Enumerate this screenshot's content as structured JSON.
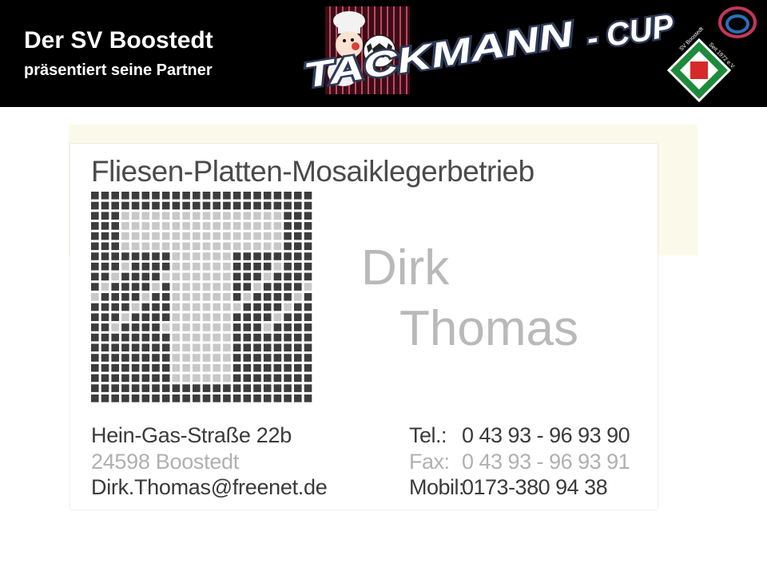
{
  "header": {
    "title": "Der SV Boostedt",
    "subtitle": "präsentiert seine Partner",
    "cup_logo_text": "TACKMANN - CUP",
    "club_badge_text": "SV Boostedt Seit 1972 e.V."
  },
  "card": {
    "trade": "Fliesen-Platten-Mosaiklegerbetrieb",
    "first_name": "Dirk",
    "last_name": "Thomas",
    "street": "Hein-Gas-Straße 22b",
    "city": "24598 Boostedt",
    "email": "Dirk.Thomas@freenet.de",
    "tel_label": "Tel.:",
    "tel": "0 43 93 - 96 93 90",
    "fax_label": "Fax:",
    "fax": "0 43 93 - 96 93 91",
    "mobile_label": "Mobil:",
    "mobile": "0173-380 94 38"
  },
  "colors": {
    "banner": "#000000",
    "cup_text": "#2e3a57",
    "badge_green": "#1e8a3c",
    "badge_red": "#d62a2a",
    "card_text_dark": "#3a3a3a",
    "card_text_light": "#b0b0b0"
  }
}
